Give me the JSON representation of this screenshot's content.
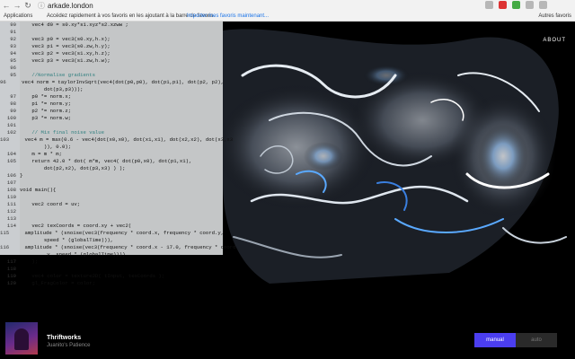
{
  "browser": {
    "url": "arkade.london",
    "back_glyph": "←",
    "forward_glyph": "→",
    "reload_glyph": "↻",
    "lock_glyph": "ⓘ",
    "bookmarks": {
      "apps_label": "Applications",
      "message": "Accédez rapidement à vos favoris en les ajoutant à la barre de favoris.",
      "import_link": "Importer mes favoris maintenant...",
      "other_label": "Autres favoris"
    }
  },
  "site": {
    "about_label": "ABOUT"
  },
  "code_editor": {
    "lines": [
      {
        "n": "90",
        "t": "    vec4 d0 = s0.xy*s1.xyz*s2.xzww ;"
      },
      {
        "n": "91",
        "t": ""
      },
      {
        "n": "92",
        "t": "    vec3 p0 = vec3(s0.xy,h.x);"
      },
      {
        "n": "93",
        "t": "    vec3 p1 = vec3(s0.zw,h.y);"
      },
      {
        "n": "94",
        "t": "    vec3 p2 = vec3(s1.xy,h.z);"
      },
      {
        "n": "95",
        "t": "    vec3 p3 = vec3(s1.zw,h.w);"
      },
      {
        "n": "96",
        "t": ""
      },
      {
        "n": "95",
        "t": "    //Normalise gradients"
      },
      {
        "n": "96",
        "t": "    vec4 norm = taylorInvSqrt(vec4(dot(p0,p0), dot(p1,p1), dot(p2, p2),"
      },
      {
        "n": "",
        "t": "        dot(p3,p3)));"
      },
      {
        "n": "97",
        "t": "    p0 *= norm.x;"
      },
      {
        "n": "98",
        "t": "    p1 *= norm.y;"
      },
      {
        "n": "99",
        "t": "    p2 *= norm.z;"
      },
      {
        "n": "100",
        "t": "    p3 *= norm.w;"
      },
      {
        "n": "101",
        "t": ""
      },
      {
        "n": "102",
        "t": "    // Mix final noise value"
      },
      {
        "n": "103",
        "t": "    vec4 m = max(0.6 - vec4(dot(x0,x0), dot(x1,x1), dot(x2,x2), dot(x3,x3"
      },
      {
        "n": "",
        "t": "        )), 0.0);"
      },
      {
        "n": "104",
        "t": "    m = m * m;"
      },
      {
        "n": "105",
        "t": "    return 42.0 * dot( m*m, vec4( dot(p0,x0), dot(p1,x1),"
      },
      {
        "n": "",
        "t": "        dot(p2,x2), dot(p3,x3) ) );"
      },
      {
        "n": "106",
        "t": "}"
      },
      {
        "n": "107",
        "t": ""
      },
      {
        "n": "108",
        "t": "void main(){"
      },
      {
        "n": "110",
        "t": ""
      },
      {
        "n": "111",
        "t": "    vec2 coord = uv;"
      },
      {
        "n": "112",
        "t": ""
      },
      {
        "n": "113",
        "t": ""
      },
      {
        "n": "114",
        "t": "    vec2 texCoords = coord.xy + vec2("
      },
      {
        "n": "115",
        "t": "    amplitude * (snoise(vec3(frequency * coord.x, frequency * coord.y,"
      },
      {
        "n": "",
        "t": "        speed * (globalTime))),"
      },
      {
        "n": "116",
        "t": "    amplitude * (snoise(vec3(frequency * coord.x - 17.0, frequency * coord"
      },
      {
        "n": "",
        "t": "        .y, speed * (globalTime))))"
      },
      {
        "n": "117",
        "t": "    );"
      },
      {
        "n": "118",
        "t": ""
      },
      {
        "n": "119",
        "t": "    vec4 color = texture2D( tInput, texCoords );"
      },
      {
        "n": "120",
        "t": "    gl_FragColor = color;"
      },
      {
        "n": "121",
        "t": ""
      },
      {
        "n": "122",
        "t": "}"
      },
      {
        "n": "123",
        "t": ""
      }
    ]
  },
  "player": {
    "track_title": "Thriftworks",
    "track_subtitle": "Juanito's Patience",
    "manual_label": "manual",
    "auto_label": "auto"
  },
  "colors": {
    "accent": "#4b3ef0",
    "glow": "#5aa9ff",
    "keyword": "#1f8a3b",
    "function": "#a01aa0",
    "comment": "#2f7f7f",
    "number": "#c03030"
  }
}
